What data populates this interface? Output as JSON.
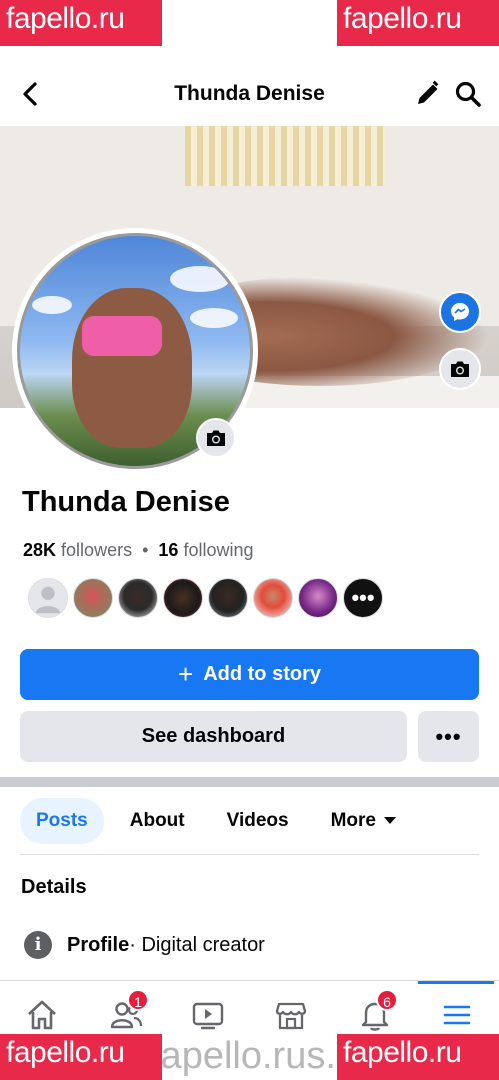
{
  "watermark": {
    "brand": "fapello.ru",
    "url": "fapello.rus.com/thu"
  },
  "header": {
    "title": "Thunda Denise"
  },
  "profile": {
    "name": "Thunda Denise",
    "followers_count": "28K",
    "followers_label": "followers",
    "separator": "•",
    "following_count": "16",
    "following_label": "following"
  },
  "friends_more_label": "•••",
  "actions": {
    "add_story_label": "Add to story",
    "add_story_plus": "+",
    "dashboard_label": "See dashboard",
    "more_label": "•••"
  },
  "tabs": [
    {
      "label": "Posts",
      "active": true
    },
    {
      "label": "About",
      "active": false
    },
    {
      "label": "Videos",
      "active": false
    },
    {
      "label": "More",
      "active": false
    }
  ],
  "details": {
    "heading": "Details",
    "row_label": "Profile",
    "row_value": " · Digital creator",
    "info_glyph": "i"
  },
  "bottom_nav": {
    "friends_badge": "1",
    "notifications_badge": "6"
  },
  "colors": {
    "accent": "#1877f2",
    "badge": "#e41e3f",
    "watermark": "#e8294a"
  }
}
